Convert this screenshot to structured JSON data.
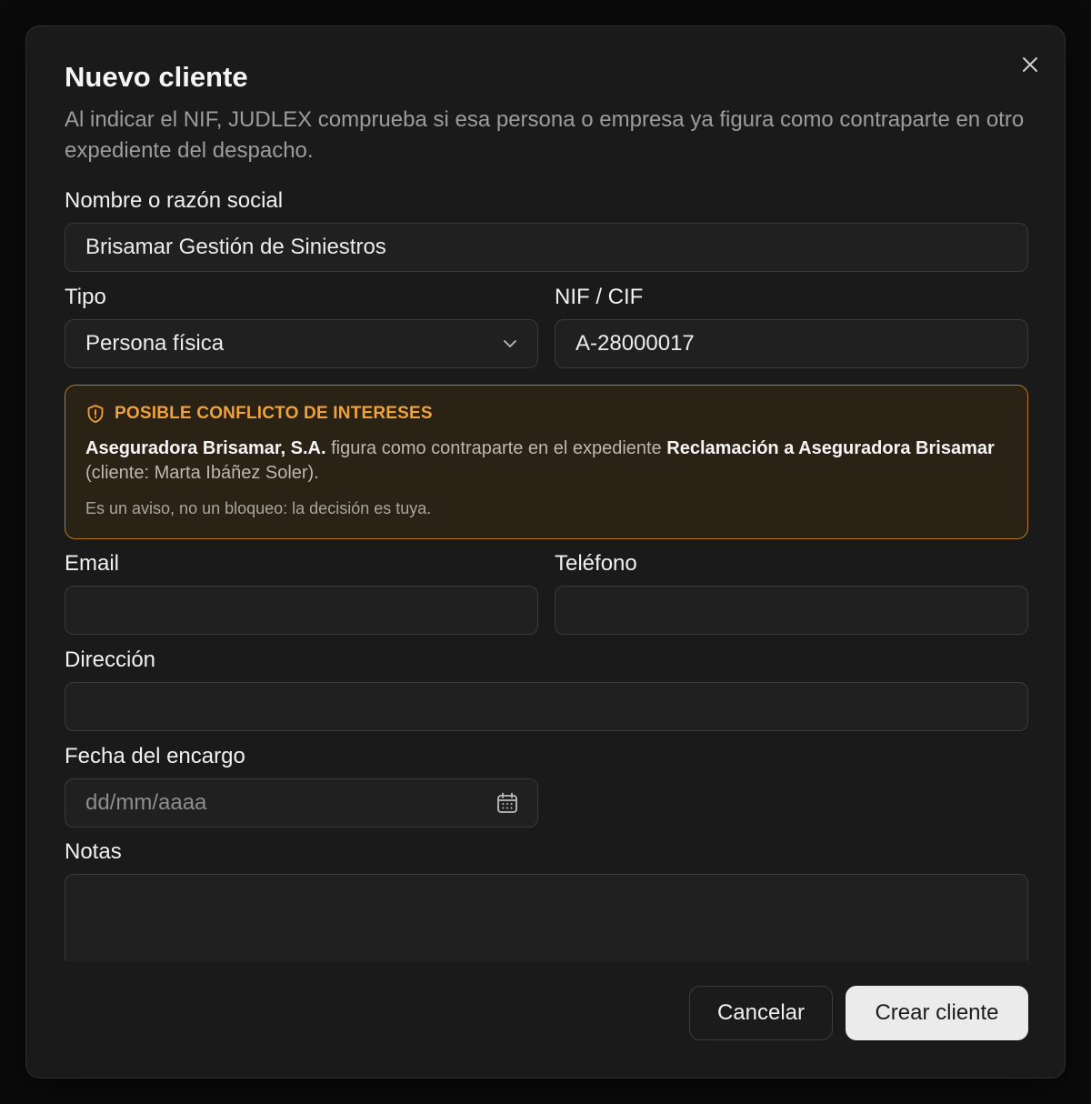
{
  "dialog": {
    "title": "Nuevo cliente",
    "description": "Al indicar el NIF, JUDLEX comprueba si esa persona o empresa ya figura como contraparte en otro expediente del despacho."
  },
  "form": {
    "name": {
      "label": "Nombre o razón social",
      "value": "Brisamar Gestión de Siniestros"
    },
    "type": {
      "label": "Tipo",
      "value": "Persona física"
    },
    "nif": {
      "label": "NIF / CIF",
      "value": "A-28000017"
    },
    "email": {
      "label": "Email",
      "value": ""
    },
    "phone": {
      "label": "Teléfono",
      "value": ""
    },
    "address": {
      "label": "Dirección",
      "value": ""
    },
    "date": {
      "label": "Fecha del encargo",
      "placeholder": "dd/mm/aaaa"
    },
    "notes": {
      "label": "Notas",
      "value": ""
    }
  },
  "warning": {
    "heading": "POSIBLE CONFLICTO DE INTERESES",
    "party": "Aseguradora Brisamar, S.A.",
    "text_mid": " figura como contraparte en el expediente ",
    "case": "Reclamación a Aseguradora Brisamar",
    "client_text": " (cliente: Marta Ibáñez Soler).",
    "note": "Es un aviso, no un bloqueo: la decisión es tuya.",
    "color": "#f0a23a"
  },
  "actions": {
    "cancel_label": "Cancelar",
    "create_label": "Crear cliente"
  },
  "icons": {
    "close": "close-icon",
    "chevron": "chevron-down-icon",
    "calendar": "calendar-icon",
    "shield": "shield-alert-icon"
  }
}
